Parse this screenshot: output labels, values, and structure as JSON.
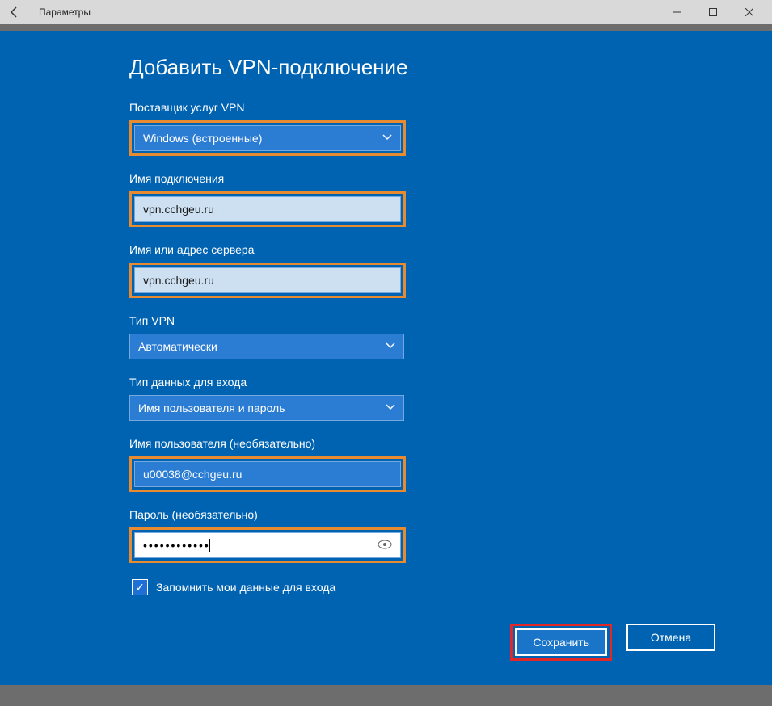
{
  "titlebar": {
    "title": "Параметры"
  },
  "heading": "Добавить VPN-подключение",
  "fields": {
    "provider": {
      "label": "Поставщик услуг VPN",
      "value": "Windows (встроенные)"
    },
    "connName": {
      "label": "Имя подключения",
      "value": "vpn.cchgeu.ru"
    },
    "server": {
      "label": "Имя или адрес сервера",
      "value": "vpn.cchgeu.ru"
    },
    "vpnType": {
      "label": "Тип VPN",
      "value": "Автоматически"
    },
    "signinType": {
      "label": "Тип данных для входа",
      "value": "Имя пользователя и пароль"
    },
    "username": {
      "label": "Имя пользователя (необязательно)",
      "value": "u00038@cchgeu.ru"
    },
    "password": {
      "label": "Пароль (необязательно)",
      "masked": "••••••••••••"
    }
  },
  "remember": {
    "label": "Запомнить мои данные для входа",
    "checked": true
  },
  "buttons": {
    "save": "Сохранить",
    "cancel": "Отмена"
  }
}
